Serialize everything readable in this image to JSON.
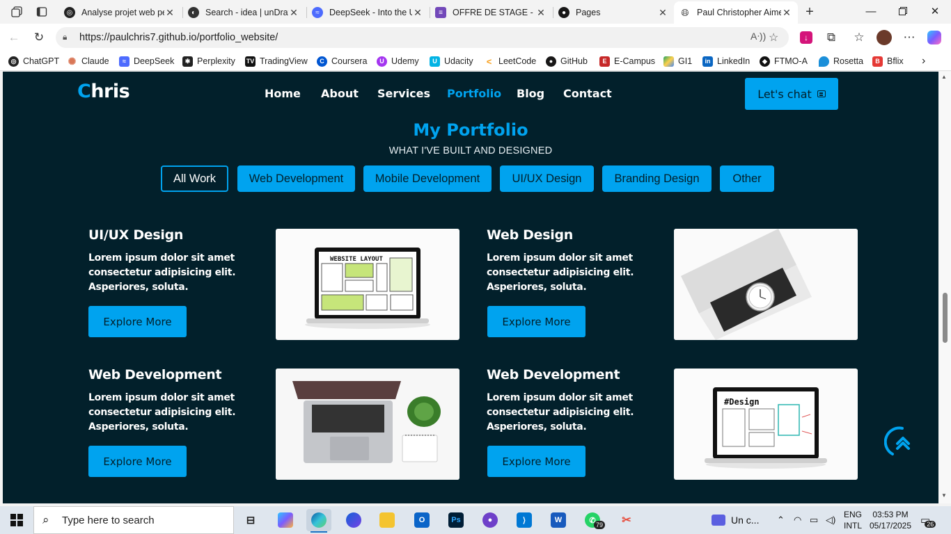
{
  "browser": {
    "tabs": [
      {
        "title": "Analyse projet web pe",
        "icon": "chatgpt-icon"
      },
      {
        "title": "Search - idea | unDraw",
        "icon": "undraw-icon"
      },
      {
        "title": "DeepSeek - Into the Unknown",
        "icon": "deepseek-icon"
      },
      {
        "title": "OFFRE DE STAGE - CA",
        "icon": "form-icon"
      },
      {
        "title": "Pages",
        "icon": "github-icon"
      },
      {
        "title": "Paul Christopher Aime",
        "icon": "globe-icon"
      }
    ],
    "url": "https://paulchris7.github.io/portfolio_website/",
    "bookmarks": [
      "ChatGPT",
      "Claude",
      "DeepSeek",
      "Perplexity",
      "TradingView",
      "Coursera",
      "Udemy",
      "Udacity",
      "LeetCode",
      "GitHub",
      "E-Campus",
      "GI1",
      "LinkedIn",
      "FTMO-A",
      "Rosetta",
      "Bflix"
    ]
  },
  "site": {
    "logo_first": "C",
    "logo_rest": "hris",
    "nav": [
      "Home",
      "About",
      "Services",
      "Portfolio",
      "Blog",
      "Contact"
    ],
    "chat_label": "Let's chat",
    "section_title": "My Portfolio",
    "section_subtitle": "WHAT I'VE BUILT AND DESIGNED",
    "filters": [
      "All Work",
      "Web Development",
      "Mobile Development",
      "UI/UX Design",
      "Branding Design",
      "Other"
    ],
    "projects": [
      {
        "title": "UI/UX Design",
        "desc": "Lorem ipsum dolor sit amet consectetur adipisicing elit. Asperiores, soluta.",
        "button": "Explore More",
        "image_label": "WEBSITE LAYOUT"
      },
      {
        "title": "Web Design",
        "desc": "Lorem ipsum dolor sit amet consectetur adipisicing elit. Asperiores, soluta.",
        "button": "Explore More",
        "image_label": ""
      },
      {
        "title": "Web Development",
        "desc": "Lorem ipsum dolor sit amet consectetur adipisicing elit. Asperiores, soluta.",
        "button": "Explore More",
        "image_label": ""
      },
      {
        "title": "Web Development",
        "desc": "Lorem ipsum dolor sit amet consectetur adipisicing elit. Asperiores, soluta.",
        "button": "Explore More",
        "image_label": "#Design"
      }
    ],
    "colors": {
      "bg": "#02202b",
      "accent": "#00a3ef",
      "text": "#ffffff"
    }
  },
  "taskbar": {
    "search_placeholder": "Type here to search",
    "whatsapp_badge": "79",
    "media": "Un c...",
    "lang_top": "ENG",
    "lang_bottom": "INTL",
    "time": "03:53 PM",
    "date": "05/17/2025",
    "notifications": "26"
  }
}
